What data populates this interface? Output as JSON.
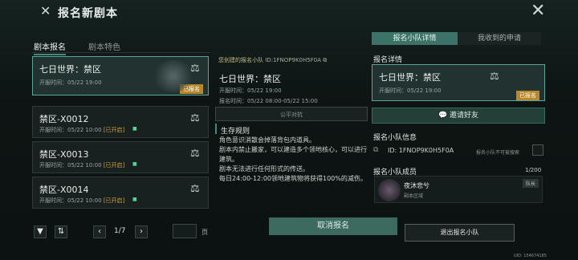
{
  "header": {
    "title": "报名新剧本"
  },
  "left": {
    "tabs": [
      "剧本报名",
      "剧本特色"
    ],
    "cards": [
      {
        "name": "七日世界：禁区",
        "time": "开服时间：05/22 19:00",
        "status": "已报名",
        "selected": true
      },
      {
        "name": "禁区-X0012",
        "time": "开服时间：05/22 10:00",
        "status": "[已开启]",
        "selected": false
      },
      {
        "name": "禁区-X0013",
        "time": "开服时间：05/22 10:00",
        "status": "[已开启]",
        "selected": false
      },
      {
        "name": "禁区-X0014",
        "time": "开服时间：05/22 10:00",
        "status": "[已开启]",
        "selected": false
      }
    ],
    "pager": {
      "page": "1/7",
      "unit": "页"
    }
  },
  "middle": {
    "team_line_prefix": "您创建的报名小队",
    "team_id": "ID:1FNOP9K0H5F0A",
    "server_name": "七日世界：禁区",
    "open_time": "开服时间：05/22 19:00",
    "signup_time": "报名时间：05/22 08:00-05/22 15:00",
    "fair_label": "公平对抗",
    "rules_title": "生存规则",
    "rules": [
      "角色意识消散会掉落背包内道具。",
      "剧本内禁止搬家，可以建造多个领地核心，可以进行建筑。",
      "剧本无法进行任何形式的传送。",
      "每日24:00-12:00领地建筑物将获得100%的减伤。"
    ],
    "cancel_btn": "取消报名"
  },
  "right": {
    "tabs": [
      "报名小队详情",
      "我收到的申请"
    ],
    "detail_title": "报名详情",
    "detail_name": "七日世界：禁区",
    "detail_time": "开服时间：05/22 19:00",
    "detail_badge": "已报名",
    "invite_btn": "邀请好友",
    "info_title": "报名小队信息",
    "team_id": "ID: 1FNOP9K0H5F0A",
    "search_note": "报名小队不可被搜索",
    "members_title": "报名小队成员",
    "members_count": "1/200",
    "member_name": "夜沐悲兮",
    "member_area": "副本区域",
    "leader_label": "队长",
    "exit_btn": "退出报名小队"
  },
  "footer": {
    "uid": "UID: 154674185"
  },
  "colors": {
    "accent": "#3e8a80",
    "highlight_blue": "#5fc3d6",
    "highlight_gold": "#d8a94b",
    "badge": "#b8892c"
  }
}
